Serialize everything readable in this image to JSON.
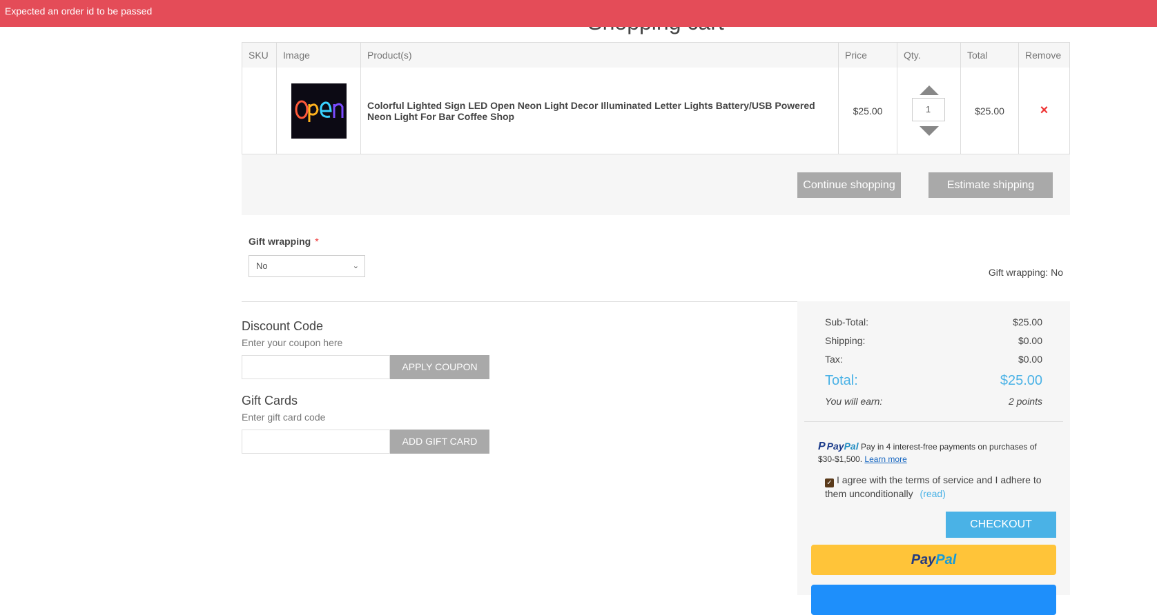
{
  "error_banner": {
    "message": "Expected an order id to be passed"
  },
  "page": {
    "title": "Shopping cart"
  },
  "cart_table": {
    "headers": {
      "sku": "SKU",
      "image": "Image",
      "product": "Product(s)",
      "price": "Price",
      "qty": "Qty.",
      "total": "Total",
      "remove": "Remove"
    },
    "rows": [
      {
        "sku": "",
        "product_name": "Colorful Lighted Sign LED Open Neon Light Decor Illuminated Letter Lights Battery/USB Powered Neon Light For Bar Coffee Shop",
        "price": "$25.00",
        "qty": "1",
        "total": "$25.00",
        "image_text": "open",
        "remove_icon": "×"
      }
    ]
  },
  "cart_actions": {
    "continue": "Continue shopping",
    "estimate": "Estimate shipping"
  },
  "gift_wrapping": {
    "label": "Gift wrapping",
    "required_mark": "*",
    "selected": "No",
    "summary": "Gift wrapping: No"
  },
  "discount": {
    "title": "Discount Code",
    "hint": "Enter your coupon here",
    "button": "APPLY COUPON"
  },
  "gift_cards": {
    "title": "Gift Cards",
    "hint": "Enter gift card code",
    "button": "ADD GIFT CARD"
  },
  "totals": {
    "subtotal_label": "Sub-Total:",
    "subtotal": "$25.00",
    "shipping_label": "Shipping:",
    "shipping": "$0.00",
    "tax_label": "Tax:",
    "tax": "$0.00",
    "total_label": "Total:",
    "total": "$25.00",
    "earn_label": "You will earn:",
    "earn": "2 points"
  },
  "paypal_message": {
    "brand_pay": "Pay",
    "brand_pal": "Pal",
    "text": "Pay in 4 interest-free payments on purchases of $30-$1,500.",
    "link": "Learn more"
  },
  "terms": {
    "text": "I agree with the terms of service and I adhere to them unconditionally",
    "read": "(read)",
    "checked": true
  },
  "checkout": {
    "button": "CHECKOUT"
  },
  "paypal_button": {
    "pay": "Pay",
    "pal": "Pal"
  },
  "colors": {
    "error": "#e44c58",
    "accent": "#4ab2e6",
    "paypal_yellow": "#ffc439",
    "paypal_blue": "#1e8ffb",
    "remove_red": "#e33333"
  }
}
